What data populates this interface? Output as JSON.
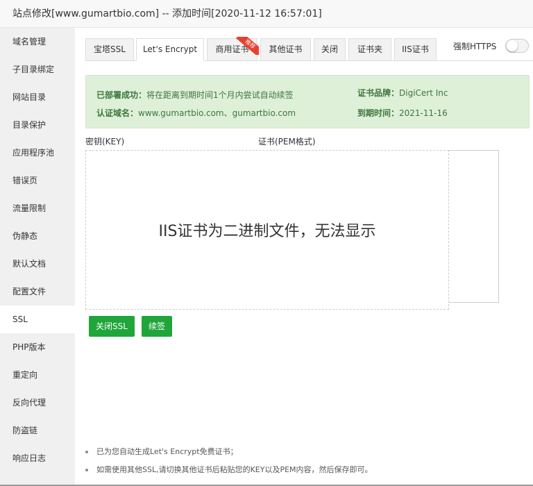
{
  "window": {
    "title": "站点修改[www.gumartbio.com] -- 添加时间[2020-11-12 16:57:01]"
  },
  "sidebar": {
    "items": [
      {
        "label": "域名管理"
      },
      {
        "label": "子目录绑定"
      },
      {
        "label": "网站目录"
      },
      {
        "label": "目录保护"
      },
      {
        "label": "应用程序池"
      },
      {
        "label": "错误页"
      },
      {
        "label": "流量限制"
      },
      {
        "label": "伪静态"
      },
      {
        "label": "默认文档"
      },
      {
        "label": "配置文件"
      },
      {
        "label": "SSL"
      },
      {
        "label": "PHP版本"
      },
      {
        "label": "重定向"
      },
      {
        "label": "反向代理"
      },
      {
        "label": "防盗链"
      },
      {
        "label": "响应日志"
      }
    ],
    "active": "SSL"
  },
  "tabs": [
    {
      "label": "宝塔SSL"
    },
    {
      "label": "Let's Encrypt"
    },
    {
      "label": "商用证书",
      "badge": "推荐"
    },
    {
      "label": "其他证书"
    },
    {
      "label": "关闭"
    },
    {
      "label": "证书夹"
    },
    {
      "label": "IIS证书"
    }
  ],
  "active_tab": "Let's Encrypt",
  "force_https": {
    "label": "强制HTTPS",
    "enabled": false
  },
  "status": {
    "deploy_label": "已部署成功：",
    "deploy_text": "将在距离到期时间1个月内尝试自动续签",
    "domain_label": "认证域名：",
    "domain_value": "www.gumartbio.com、gumartbio.com",
    "brand_label": "证书品牌：",
    "brand_value": "DigiCert Inc",
    "expiry_label": "到期时间：",
    "expiry_value": "2021-11-16"
  },
  "fields": {
    "key_label": "密钥(KEY)",
    "cert_label": "证书(PEM格式)",
    "iis_notice": "IIS证书为二进制文件，无法显示"
  },
  "buttons": {
    "close_ssl": "关闭SSL",
    "renew": "续签"
  },
  "notes": [
    "已为您自动生成Let's Encrypt免费证书；",
    "如需使用其他SSL,请切换其他证书后粘贴您的KEY以及PEM内容，然后保存即可。"
  ],
  "colors": {
    "primary": "#20a53a",
    "success_bg": "#dff0d8",
    "success_text": "#3c763d",
    "badge": "#e8402f"
  }
}
